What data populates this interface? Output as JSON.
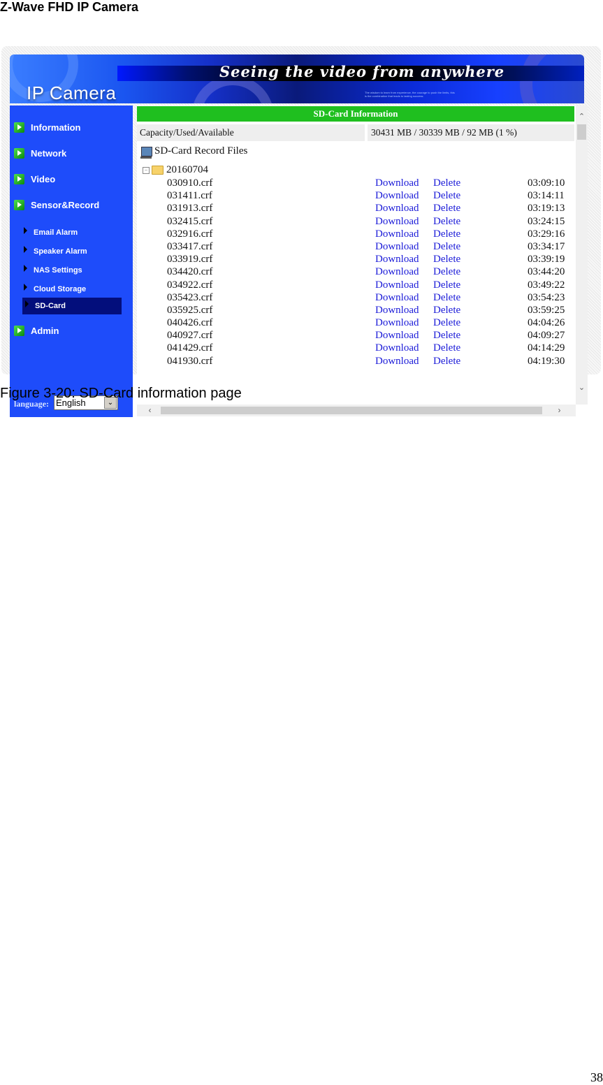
{
  "document": {
    "header": "Z-Wave FHD IP Camera",
    "caption": "Figure 3-20: SD-Card information page",
    "page_number": "38"
  },
  "banner": {
    "logo": "IP Camera",
    "slogan": "Seeing the video from anywhere",
    "tagline": "The wisdom to learn from experience, the courage to push the limits, this is the combination that leads to lasting success."
  },
  "sidebar": {
    "items": [
      {
        "label": "Information",
        "type": "main"
      },
      {
        "label": "Network",
        "type": "main"
      },
      {
        "label": "Video",
        "type": "main"
      },
      {
        "label": "Sensor&Record",
        "type": "main"
      },
      {
        "label": "Email Alarm",
        "type": "sub"
      },
      {
        "label": "Speaker Alarm",
        "type": "sub"
      },
      {
        "label": "NAS Settings",
        "type": "sub"
      },
      {
        "label": "Cloud Storage",
        "type": "sub"
      },
      {
        "label": "SD-Card",
        "type": "sub",
        "active": true
      },
      {
        "label": "Admin",
        "type": "main"
      }
    ],
    "language_label": "language:",
    "language_value": "English"
  },
  "content": {
    "title": "SD-Card Information",
    "capacity_label": "Capacity/Used/Available",
    "capacity_value": "30431 MB / 30339 MB / 92 MB (1 %)",
    "files_title": "SD-Card Record Files",
    "folder": "20160704",
    "download_label": "Download",
    "delete_label": "Delete",
    "files": [
      {
        "name": "030910.crf",
        "time": "03:09:10"
      },
      {
        "name": "031411.crf",
        "time": "03:14:11"
      },
      {
        "name": "031913.crf",
        "time": "03:19:13"
      },
      {
        "name": "032415.crf",
        "time": "03:24:15"
      },
      {
        "name": "032916.crf",
        "time": "03:29:16"
      },
      {
        "name": "033417.crf",
        "time": "03:34:17"
      },
      {
        "name": "033919.crf",
        "time": "03:39:19"
      },
      {
        "name": "034420.crf",
        "time": "03:44:20"
      },
      {
        "name": "034922.crf",
        "time": "03:49:22"
      },
      {
        "name": "035423.crf",
        "time": "03:54:23"
      },
      {
        "name": "035925.crf",
        "time": "03:59:25"
      },
      {
        "name": "040426.crf",
        "time": "04:04:26"
      },
      {
        "name": "040927.crf",
        "time": "04:09:27"
      },
      {
        "name": "041429.crf",
        "time": "04:14:29"
      },
      {
        "name": "041930.crf",
        "time": "04:19:30"
      }
    ]
  },
  "colors": {
    "sidebar": "#1e4cfa",
    "sidebar_active": "#030e7c",
    "title_bar": "#1fbf1f",
    "link": "#1a1ad8"
  }
}
